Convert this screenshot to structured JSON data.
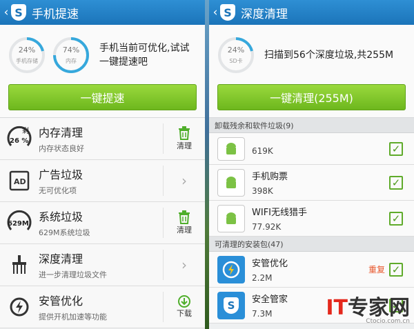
{
  "left": {
    "title": "手机提速",
    "gauges": [
      {
        "pct": "24%",
        "label": "手机存储",
        "value": 0.24
      },
      {
        "pct": "74%",
        "label": "内存",
        "value": 0.74
      }
    ],
    "summary": "手机当前可优化,试试一键提速吧",
    "button": "一键提速",
    "rows": [
      {
        "title": "内存清理",
        "sub": "内存状态良好",
        "action": "清理",
        "badge_top": "剩",
        "badge_val": "26 %"
      },
      {
        "title": "广告垃圾",
        "sub": "无可优化项",
        "action": ""
      },
      {
        "title": "系统垃圾",
        "sub": "629M系统垃圾",
        "action": "清理",
        "badge_val": "629M"
      },
      {
        "title": "深度清理",
        "sub": "进一步清理垃圾文件",
        "action": ""
      },
      {
        "title": "安管优化",
        "sub": "提供开机加速等功能",
        "action": "下载"
      }
    ]
  },
  "right": {
    "title": "深度清理",
    "gauge": {
      "pct": "24%",
      "label": "SD卡",
      "value": 0.24
    },
    "summary": "扫描到56个深度垃圾,共255M",
    "button": "一键清理(255M)",
    "section1": "卸载残余和软件垃圾(9)",
    "section2": "可清理的安装包(47)",
    "apps1": [
      {
        "name": "",
        "size": "619K"
      },
      {
        "name": "手机购票",
        "size": "398K"
      },
      {
        "name": "WIFI无线猎手",
        "size": "77.92K"
      }
    ],
    "apps2": [
      {
        "name": "安管优化",
        "size": "2.2M",
        "tag": "重复"
      },
      {
        "name": "安全管家",
        "size": "7.3M",
        "tag": ""
      }
    ]
  },
  "watermark": {
    "it": "IT",
    "zj": "专家网",
    "small": "Ctocio.com.cn"
  },
  "colors": {
    "appbar": "#1b74b9",
    "button": "#7ac426",
    "accent": "#36a8dc",
    "tag": "#e8552a"
  }
}
